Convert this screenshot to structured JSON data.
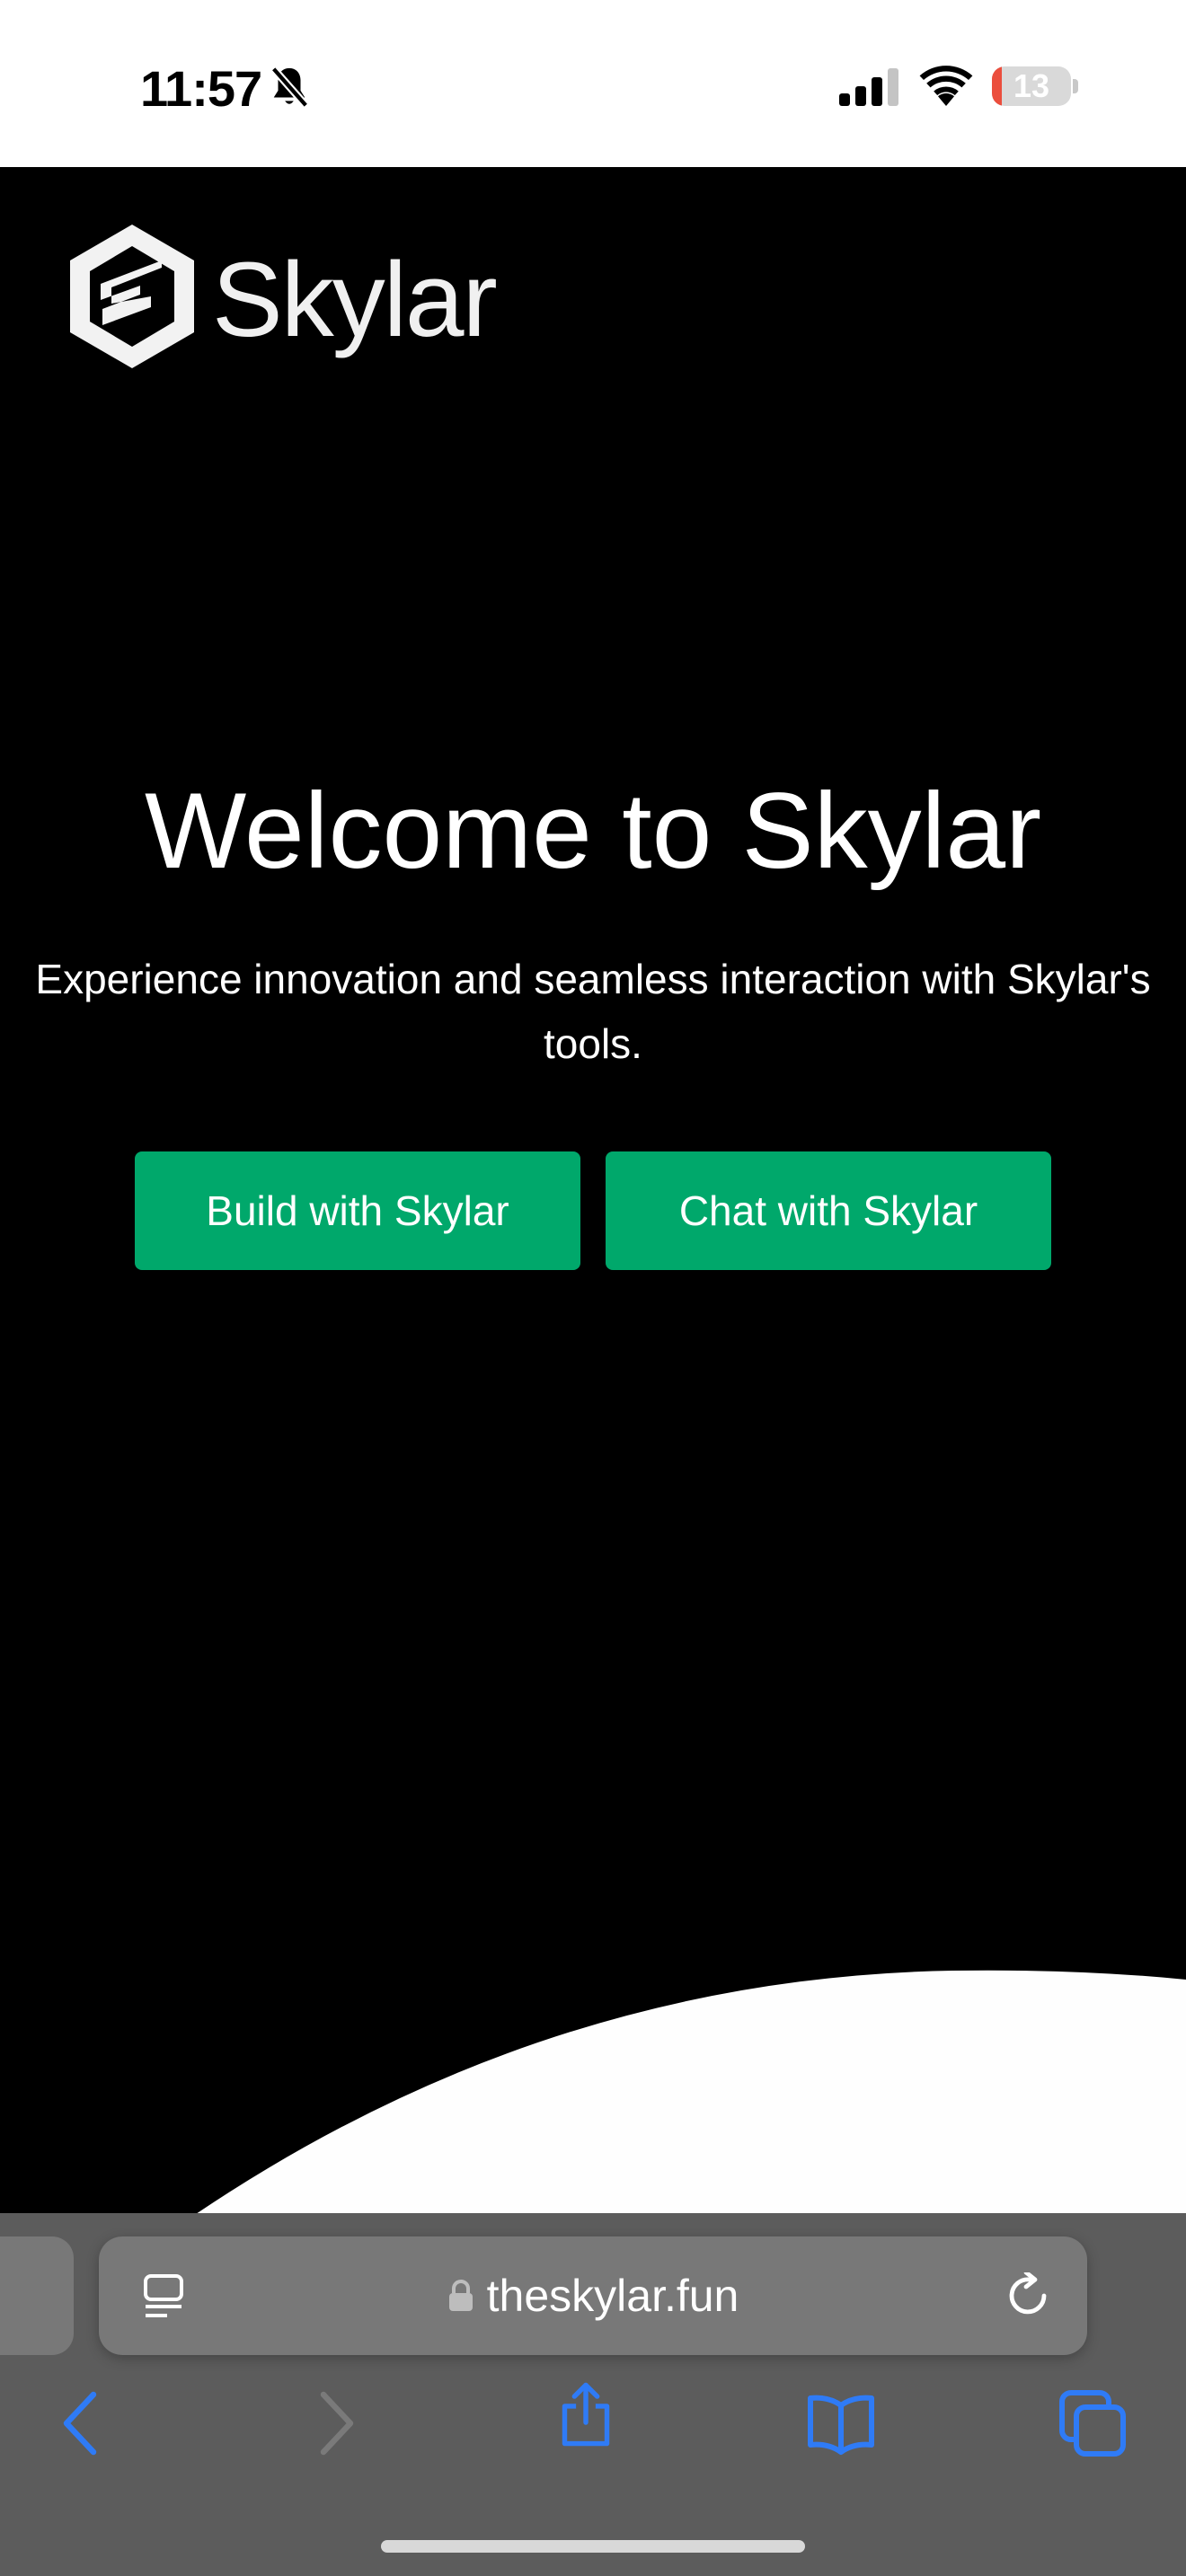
{
  "status_bar": {
    "time": "11:57",
    "battery_level": "13",
    "battery_fraction": 0.13,
    "icons": [
      "bell-slash-icon",
      "cellular-signal-icon",
      "wifi-icon",
      "battery-icon"
    ]
  },
  "brand": {
    "name": "Skylar",
    "logo_icon": "hexagon-s-logo"
  },
  "hero": {
    "title": "Welcome to Skylar",
    "subtitle_line1": "Experience innovation and seamless interaction with Skylar's",
    "subtitle_line2": "tools."
  },
  "buttons": {
    "build": "Build with Skylar",
    "chat": "Chat with Skylar"
  },
  "browser": {
    "url": "theskylar.fun",
    "icons": [
      "reader-icon",
      "lock-icon",
      "reload-icon",
      "back-chevron-icon",
      "forward-chevron-icon",
      "share-icon",
      "bookmarks-icon",
      "tabs-icon"
    ]
  },
  "colors": {
    "page_background": "#000000",
    "accent_green": "#00a86b",
    "ios_blue": "#2f7bf6",
    "browser_chrome": "#5c5c5c",
    "battery_low": "#eb4e3d"
  }
}
